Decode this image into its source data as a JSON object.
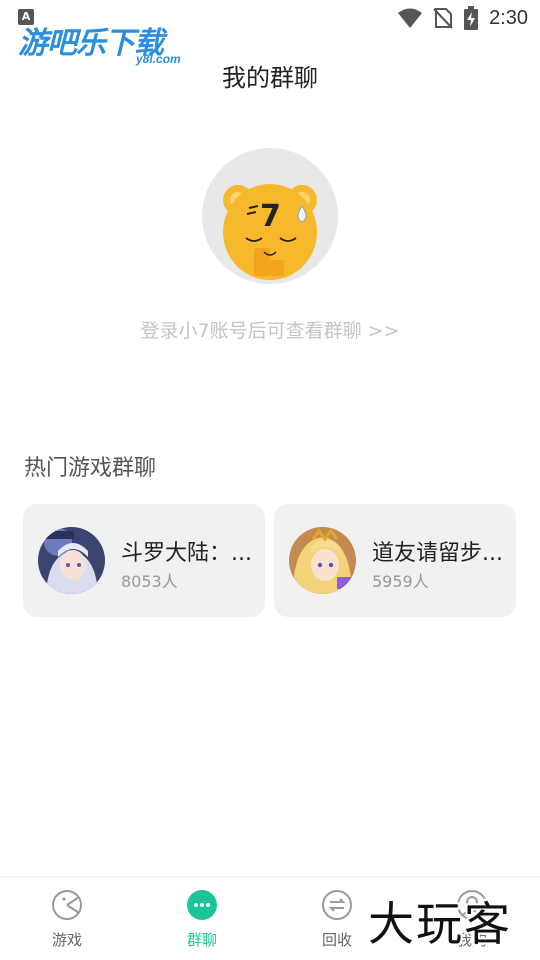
{
  "status_bar": {
    "badge": "A",
    "time": "2:30",
    "icons": [
      "wifi-icon",
      "no-sim-icon",
      "battery-charging-icon"
    ]
  },
  "logo": {
    "main": "游吧乐下载",
    "sub": "y8l.com"
  },
  "header": {
    "title": "我的群聊"
  },
  "empty_state": {
    "mascot_icon": "mascot-7-icon",
    "login_prompt": "登录小7账号后可查看群聊 >>"
  },
  "hot_groups": {
    "title": "热门游戏群聊",
    "items": [
      {
        "name": "斗罗大陆：...",
        "count": "8053人",
        "avatar_icon": "anime-girl-avatar"
      },
      {
        "name": "道友请留步...",
        "count": "5959人",
        "avatar_icon": "blonde-heroine-avatar"
      }
    ]
  },
  "bottom_nav": {
    "items": [
      {
        "label": "游戏",
        "icon": "game-icon",
        "active": false
      },
      {
        "label": "群聊",
        "icon": "chat-icon",
        "active": true
      },
      {
        "label": "回收",
        "icon": "recycle-icon",
        "active": false
      },
      {
        "label": "我的",
        "icon": "profile-icon",
        "active": false
      }
    ]
  },
  "watermark": "大玩客",
  "colors": {
    "accent": "#1cc49a",
    "card_bg": "#f1f1f1",
    "mascot": "#f6b92b",
    "logo_blue": "#2a8fe0"
  }
}
